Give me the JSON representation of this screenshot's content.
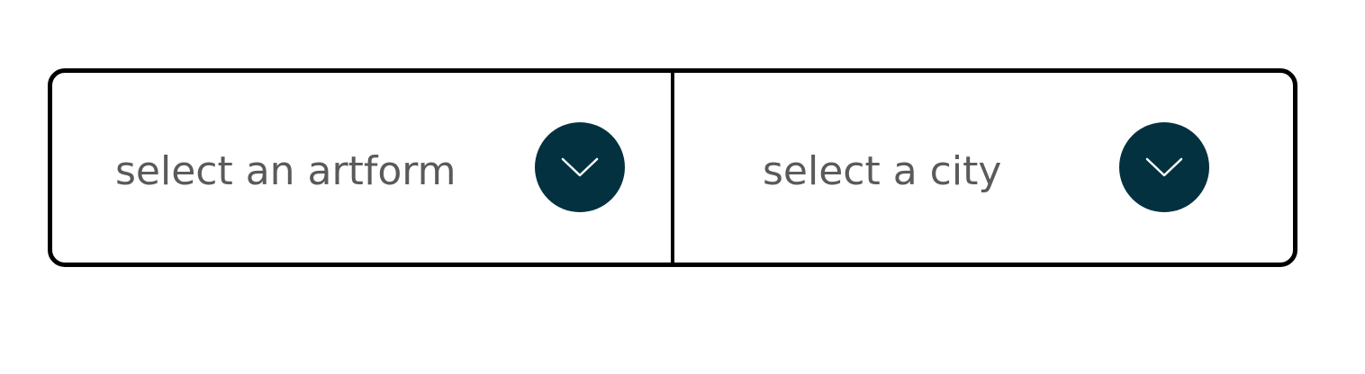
{
  "filters": {
    "artform": {
      "placeholder": "select an artform",
      "icon": "chevron-down-icon"
    },
    "city": {
      "placeholder": "select a city",
      "icon": "chevron-down-icon"
    }
  },
  "colors": {
    "border": "#000000",
    "button_bg": "#033140",
    "chevron": "#ffffff",
    "placeholder_text": "#5a5a5a",
    "background": "#ffffff"
  }
}
